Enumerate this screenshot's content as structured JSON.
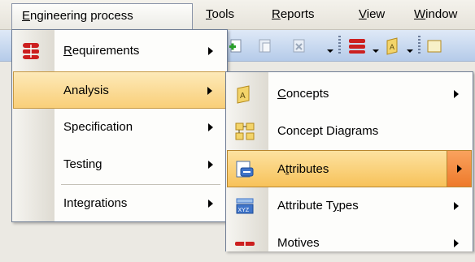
{
  "menubar": {
    "items": [
      {
        "label": "Engineering process",
        "accel": "E",
        "active": true
      },
      {
        "label": "Tools",
        "accel": "T"
      },
      {
        "label": "Reports",
        "accel": "R"
      },
      {
        "label": "View",
        "accel": "V"
      },
      {
        "label": "Window",
        "accel": "W"
      }
    ]
  },
  "toolbar": {
    "icons": [
      "add-document-icon",
      "pasted-document-icon",
      "delete-document-icon",
      "concept-network-icon",
      "concept-icon"
    ]
  },
  "menu": {
    "items": [
      {
        "label_pre": "",
        "label_accel": "R",
        "label_post": "equirements",
        "icon": "requirements-icon",
        "submenu": true
      },
      {
        "label": "Analysis",
        "submenu": true,
        "highlighted": true
      },
      {
        "label": "Specification",
        "submenu": true
      },
      {
        "label": "Testing",
        "submenu": true
      },
      {
        "label": "Integrations",
        "submenu": true
      }
    ]
  },
  "submenu": {
    "items": [
      {
        "label_pre": "",
        "label_accel": "C",
        "label_post": "oncepts",
        "icon": "concepts-icon",
        "submenu": true
      },
      {
        "label": "Concept Diagrams",
        "icon": "concept-diagrams-icon",
        "submenu": false
      },
      {
        "label_pre": "A",
        "label_accel": "t",
        "label_post": "tributes",
        "icon": "attributes-icon",
        "submenu": true,
        "highlighted": true
      },
      {
        "label_pre": "Attribute T",
        "label_accel": "y",
        "label_post": "pes",
        "icon": "attribute-types-icon",
        "submenu": true
      },
      {
        "label": "Motives",
        "icon": "motives-icon",
        "submenu": true
      }
    ]
  },
  "colors": {
    "highlight": "#f9cf79",
    "arrow_highlight": "#ee7a2b",
    "toolbar": "#b5cbe9",
    "requirements_red": "#cc1f1f"
  }
}
